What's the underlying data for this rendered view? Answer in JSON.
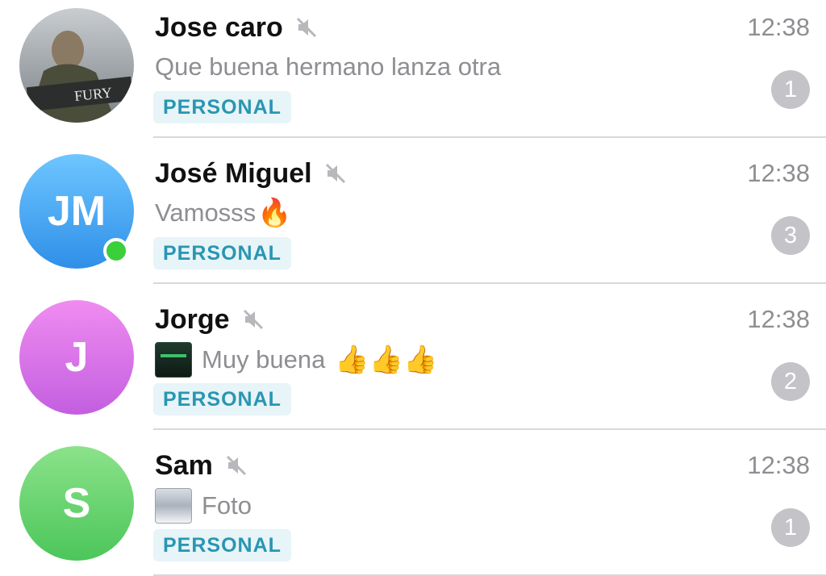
{
  "chats": [
    {
      "name": "Jose caro",
      "muted": true,
      "time": "12:38",
      "preview": "Que buena hermano lanza otra",
      "tag": "PERSONAL",
      "unread": "1",
      "avatar": {
        "type": "photo",
        "text": "FURY"
      }
    },
    {
      "name": "José Miguel",
      "muted": true,
      "time": "12:38",
      "preview": "Vamosss",
      "preview_emoji": "🔥",
      "tag": "PERSONAL",
      "unread": "3",
      "avatar": {
        "type": "initials",
        "initials": "JM",
        "color": "#4aa8f5"
      },
      "online": true
    },
    {
      "name": "Jorge",
      "muted": true,
      "time": "12:38",
      "preview": "Muy buena",
      "preview_emoji": "👍👍👍",
      "tag": "PERSONAL",
      "unread": "2",
      "avatar": {
        "type": "initials",
        "initials": "J",
        "color": "#d876e8"
      },
      "preview_thumbnail": "image-thumbnail"
    },
    {
      "name": "Sam",
      "muted": true,
      "time": "12:38",
      "preview": "Foto",
      "tag": "PERSONAL",
      "unread": "1",
      "avatar": {
        "type": "initials",
        "initials": "S",
        "color": "#6ad36f"
      },
      "preview_thumbnail": "photo-thumbnail"
    }
  ],
  "icons": {
    "mute": "mute-icon"
  },
  "colors": {
    "tag_text": "#2996b2",
    "tag_bg": "#e7f4f8",
    "badge_bg": "#c4c4c8",
    "online": "#3ccf3c"
  }
}
